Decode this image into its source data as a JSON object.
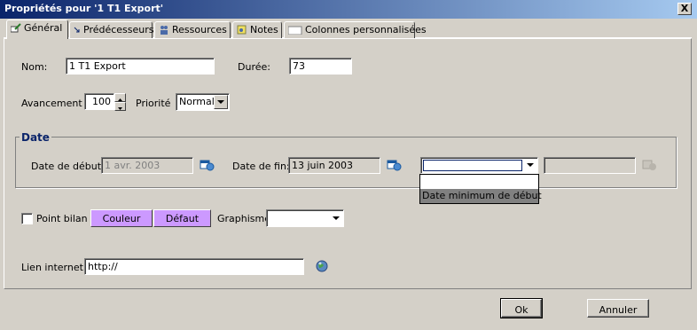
{
  "window": {
    "title": "Propriétés pour '1 T1 Export'",
    "close_label": "X"
  },
  "tabs": [
    {
      "label": "Général",
      "active": true
    },
    {
      "label": "Prédécesseurs"
    },
    {
      "label": "Ressources"
    },
    {
      "label": "Notes"
    },
    {
      "label": "Colonnes personnalisées"
    }
  ],
  "general": {
    "name_label": "Nom:",
    "name_value": "1 T1 Export",
    "duration_label": "Durée:",
    "duration_value": "73",
    "progress_label": "Avancement",
    "progress_value": "100",
    "priority_label": "Priorité",
    "priority_value": "Normale"
  },
  "date": {
    "legend": "Date",
    "start_label": "Date de début:",
    "start_value": "1 avr. 2003",
    "end_label": "Date de fin:",
    "end_value": "13 juin 2003",
    "constraint_value": "",
    "constraint_options": [
      "",
      "Date minimum de début"
    ],
    "constraint_date_value": ""
  },
  "display": {
    "milestone_label": "Point bilan",
    "color_button": "Couleur",
    "default_button": "Défaut",
    "style_label": "Graphisme",
    "style_value": ""
  },
  "link": {
    "label": "Lien internet",
    "value": "http://"
  },
  "footer": {
    "ok": "Ok",
    "cancel": "Annuler"
  },
  "colors": {
    "titlebar_start": "#0a246a",
    "titlebar_end": "#a6caf0",
    "accent_purple": "#cc99ff",
    "selection": "#0a246a"
  }
}
